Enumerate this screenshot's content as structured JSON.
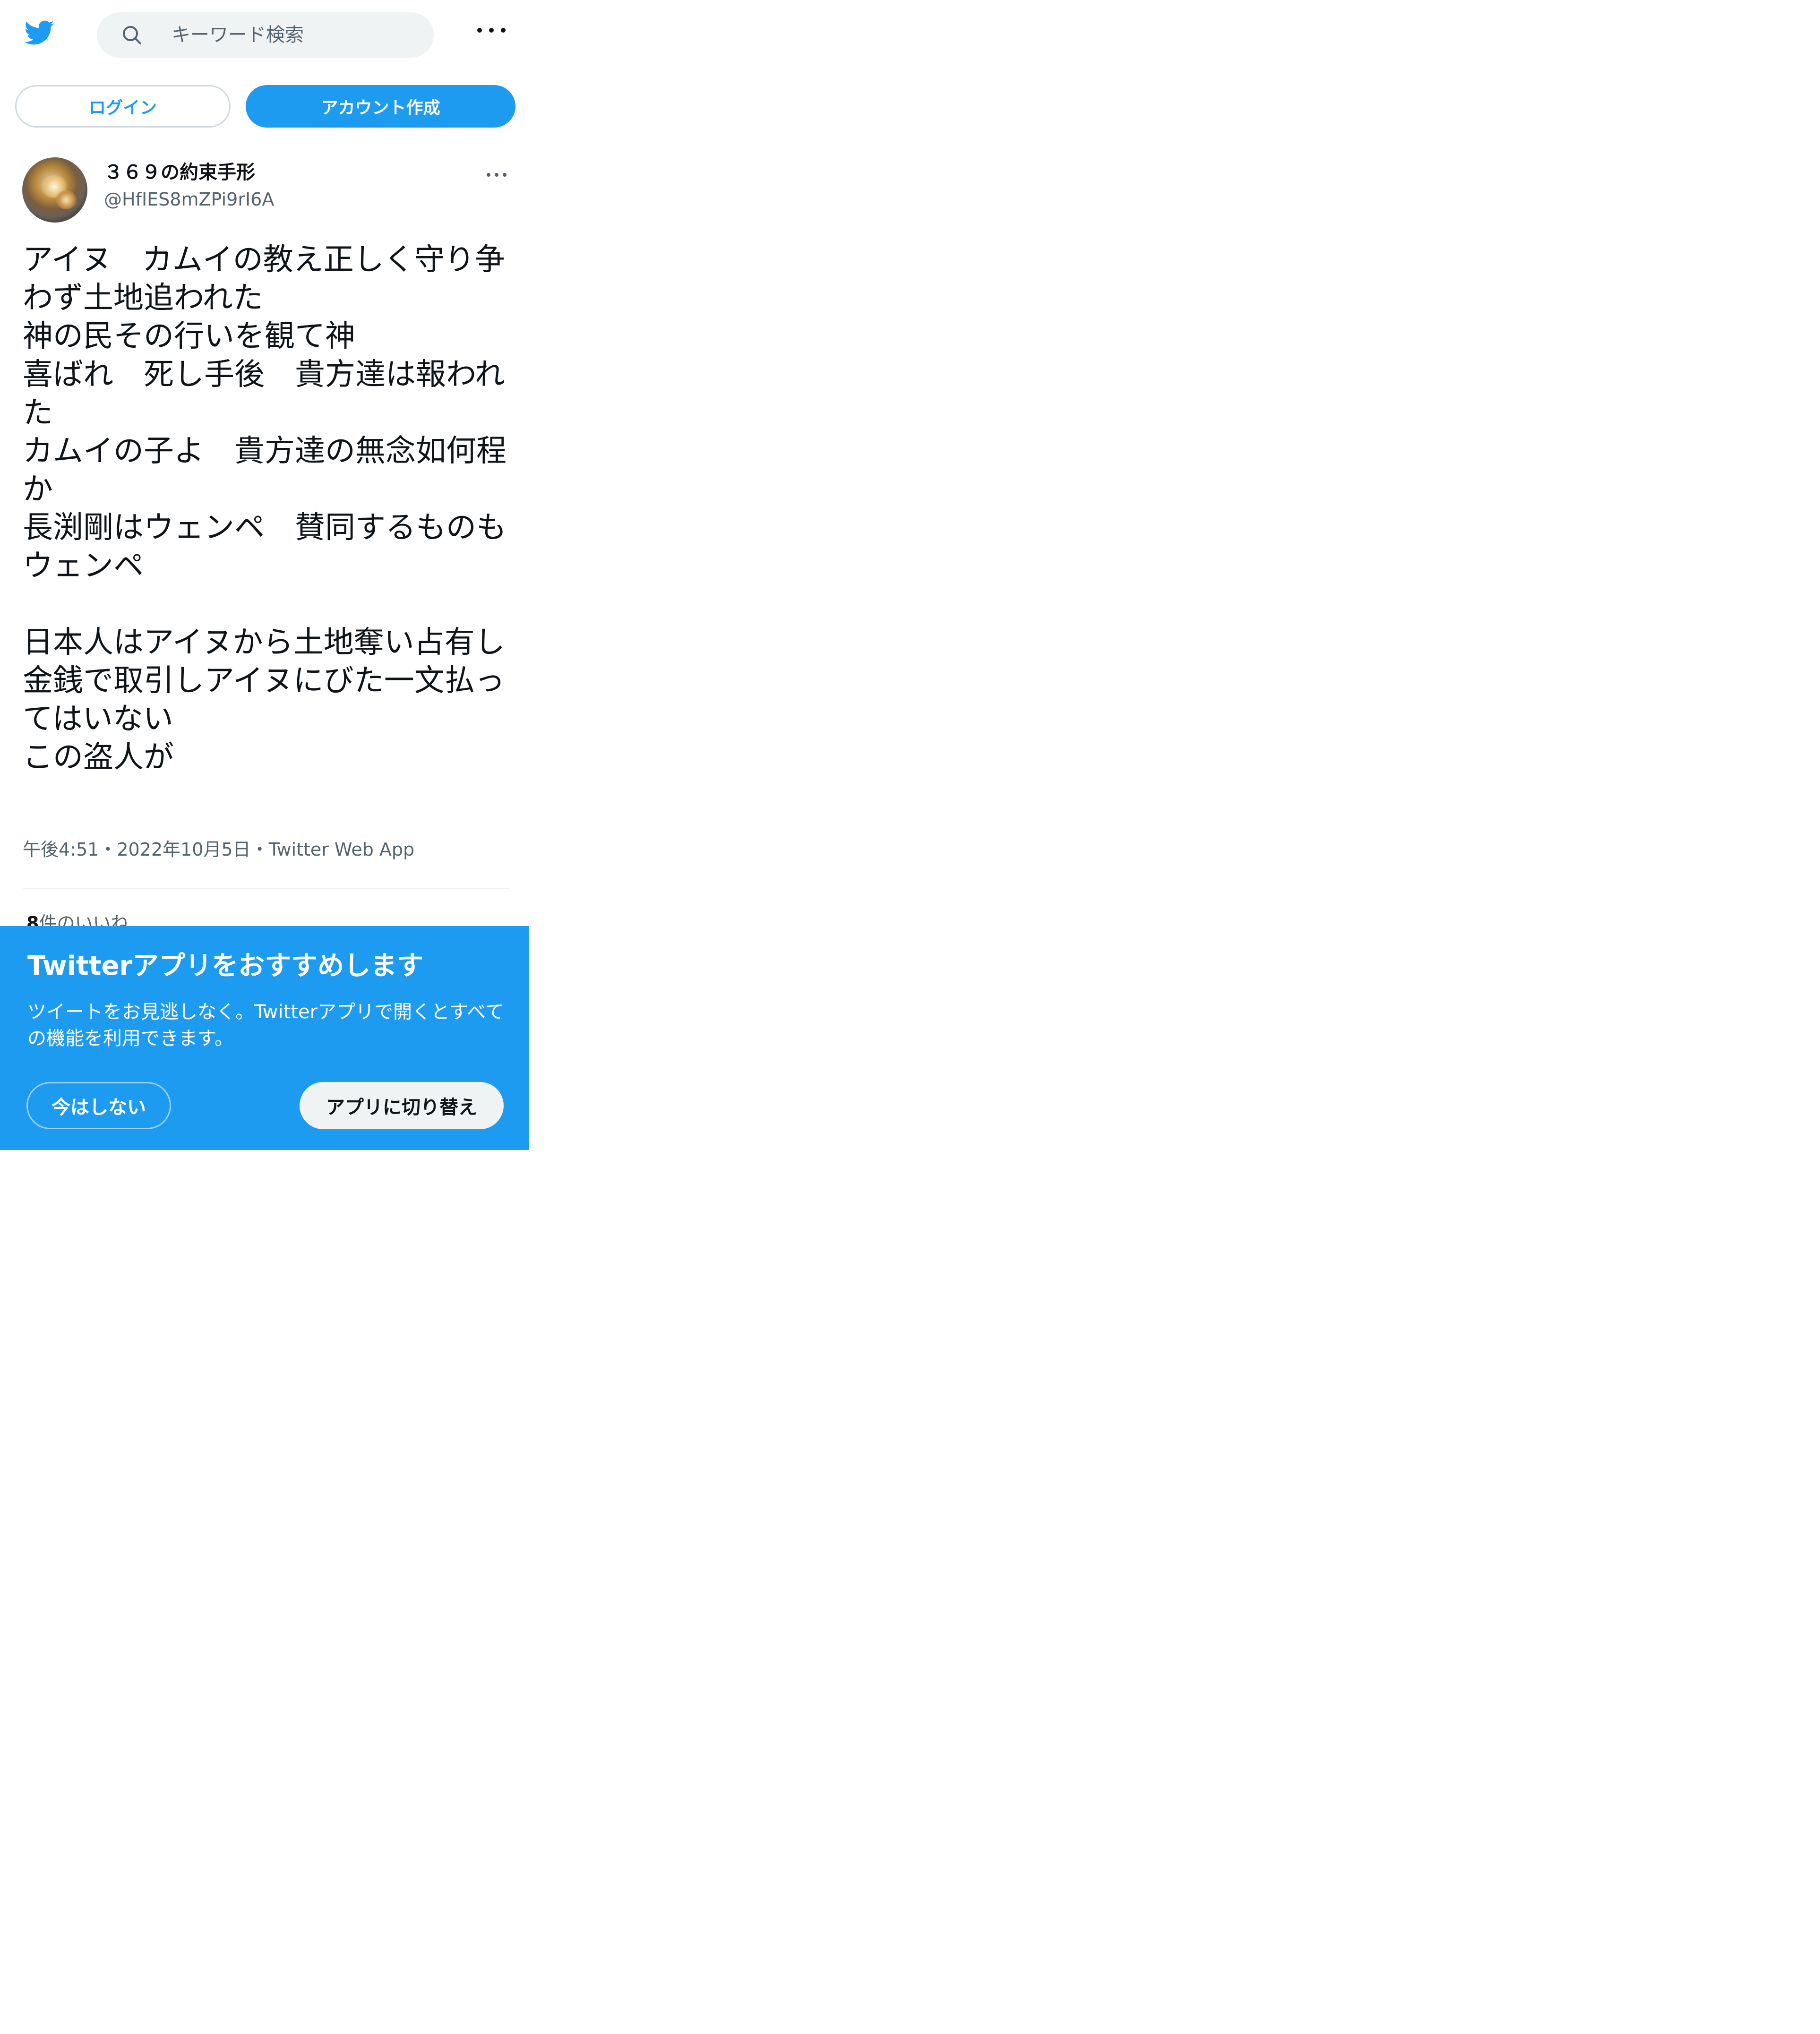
{
  "header": {
    "logo_icon": "twitter-bird-icon",
    "search_icon": "search-icon",
    "search_placeholder": "キーワード検索",
    "more_icon": "more-icon"
  },
  "auth": {
    "login_label": "ログイン",
    "signup_label": "アカウント作成"
  },
  "tweet": {
    "display_name": "３６９の約束手形",
    "handle": "@HfIES8mZPi9rI6A",
    "more_icon": "more-icon",
    "text": "アイヌ　カムイの教え正しく守り争わず土地追われた\n神の民その行いを観て神\n喜ばれ　死し手後　貴方達は報われた\nカムイの子よ　貴方達の無念如何程か\n長渕剛はウェンペ　賛同するものもウェンペ\n\n日本人はアイヌから土地奪い占有し\n金銭で取引しアイヌにびた一文払ってはいない\nこの盗人が",
    "meta": "午後4:51・2022年10月5日・Twitter Web App",
    "likes_count": "8",
    "likes_label": "件のいいね"
  },
  "promo": {
    "title": "Twitterアプリをおすすめします",
    "description": "ツイートをお見逃しなく。Twitterアプリで開くとすべての機能を利用できます。",
    "not_now_label": "今はしない",
    "switch_label": "アプリに切り替え"
  },
  "colors": {
    "brand": "#1d9bf0",
    "text": "#0f1419",
    "secondary_text": "#536471",
    "search_bg": "#eff3f4"
  }
}
